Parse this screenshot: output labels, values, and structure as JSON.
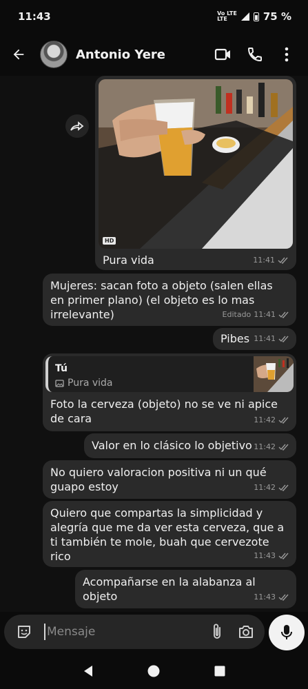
{
  "status_bar": {
    "time": "11:43",
    "network_line1": "Vo LTE",
    "network_line2": "LTE",
    "battery": "75 %"
  },
  "header": {
    "contact_name": "Antonio Yere"
  },
  "messages": [
    {
      "type": "media",
      "caption": "Pura vida",
      "badge": "HD",
      "time": "11:41"
    },
    {
      "type": "text",
      "text": "Mujeres: sacan foto a objeto (salen ellas en primer plano) (el objeto es lo mas irrelevante)",
      "edited": "Editado",
      "time": "11:41"
    },
    {
      "type": "text",
      "text": "Pibes",
      "time": "11:41"
    },
    {
      "type": "reply",
      "reply_to_name": "Tú",
      "reply_to_text": "Pura vida",
      "text": "Foto la cerveza (objeto) no se ve ni apice de cara",
      "time": "11:42"
    },
    {
      "type": "text",
      "text": "Valor en lo clásico lo objetivo",
      "time": "11:42"
    },
    {
      "type": "text",
      "text": "No quiero valoracion positiva ni un qué guapo estoy",
      "time": "11:42"
    },
    {
      "type": "text",
      "text": "Quiero que compartas la simplicidad y alegría que me da ver esta cerveza, que a ti también te mole, buah que cervezote rico",
      "time": "11:43"
    },
    {
      "type": "text",
      "text": "Acompañarse en la alabanza al objeto",
      "time": "11:43"
    }
  ],
  "composer": {
    "placeholder": "Mensaje"
  },
  "colors": {
    "background": "#0b0b0b",
    "bubble": "#2a2a2a",
    "meta_text": "#9a9a9a"
  }
}
